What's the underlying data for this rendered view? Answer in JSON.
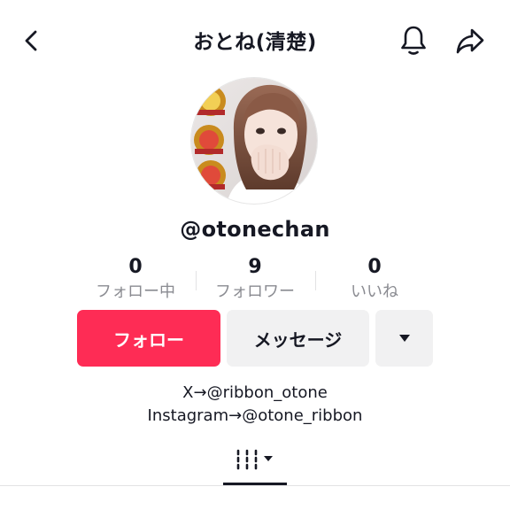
{
  "header": {
    "title": "おとね(清楚)",
    "back_icon": "chevron-left-icon",
    "bell_icon": "bell-icon",
    "share_icon": "share-icon"
  },
  "profile": {
    "username": "@otonechan",
    "avatar_icon": "profile-photo"
  },
  "stats": [
    {
      "count": "0",
      "label": "フォロー中"
    },
    {
      "count": "9",
      "label": "フォロワー"
    },
    {
      "count": "0",
      "label": "いいね"
    }
  ],
  "actions": {
    "follow_label": "フォロー",
    "message_label": "メッセージ",
    "more_icon": "triangle-down-icon"
  },
  "bio": {
    "line1": "X→@ribbon_otone",
    "line2": "Instagram→@otone_ribbon"
  },
  "tabs": {
    "videos_icon": "grid-columns-icon",
    "dropdown_icon": "caret-down-icon"
  },
  "colors": {
    "accent": "#fe2c55",
    "text": "#161823",
    "secondary_text": "#8a8b91",
    "button_gray": "#f1f1f2"
  }
}
